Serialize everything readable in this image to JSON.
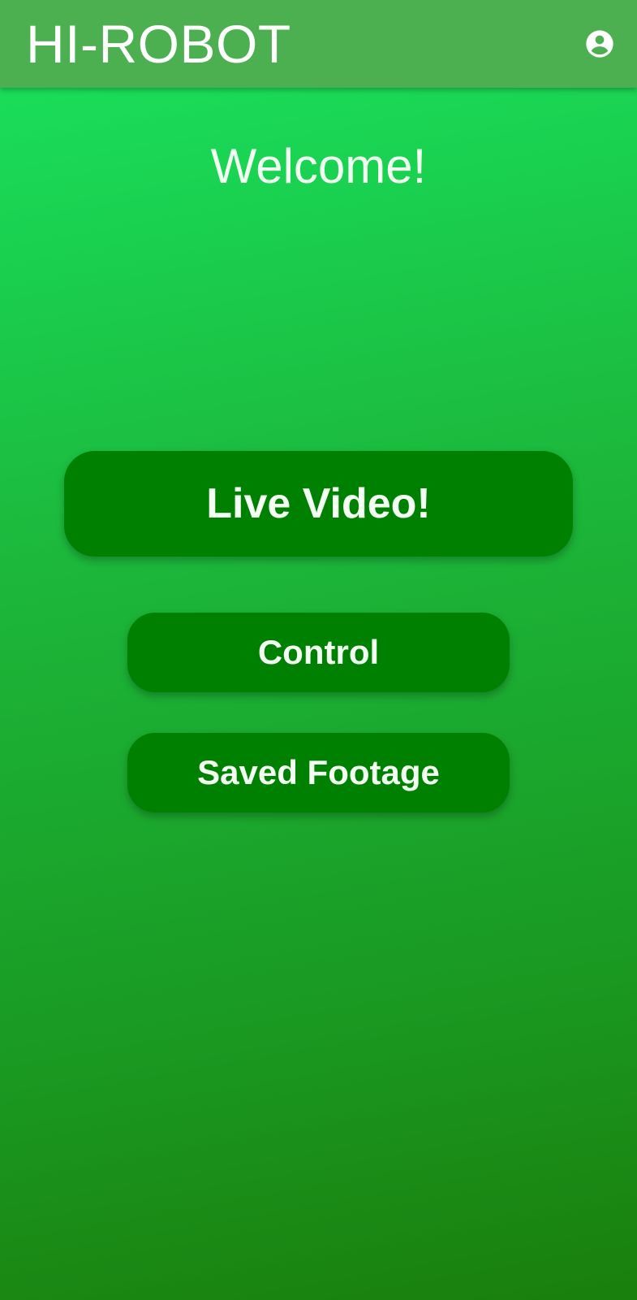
{
  "app_bar": {
    "title": "HI-ROBOT",
    "account_icon": "account-circle-icon",
    "background_color": "#4caf50"
  },
  "main": {
    "welcome_text": "Welcome!",
    "buttons": {
      "live_video": "Live Video!",
      "control": "Control",
      "saved_footage": "Saved Footage"
    },
    "button_color": "#008000"
  },
  "colors": {
    "background_gradient_top": "#19e45f",
    "background_gradient_bottom": "#1a7f0c",
    "text": "#ffffff"
  }
}
